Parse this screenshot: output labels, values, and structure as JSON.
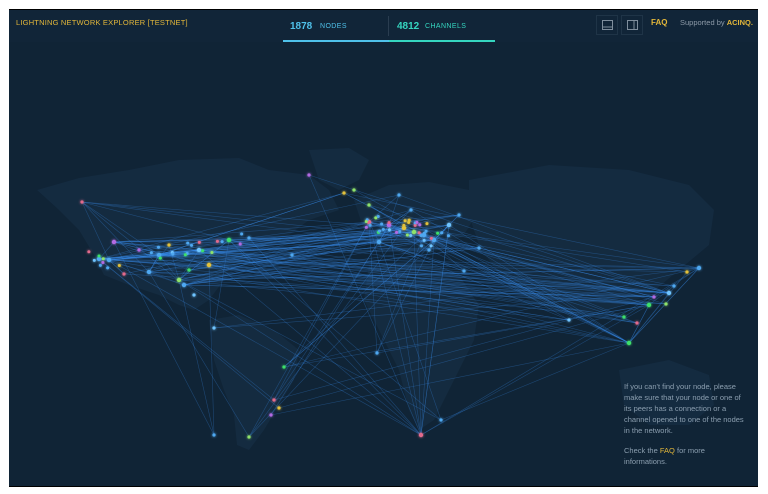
{
  "app": {
    "title": "LIGHTNING NETWORK EXPLORER [TESTNET]"
  },
  "stats": {
    "nodes_count": "1878",
    "nodes_label": "NODES",
    "channels_count": "4812",
    "channels_label": "CHANNELS"
  },
  "header": {
    "faq_label": "FAQ",
    "supported_by": "Supported by",
    "sponsor": "ACINQ."
  },
  "info": {
    "paragraph1": "If you can't find your node, please make sure that your node or one of its peers has a connection or a channel opened to one of the nodes in the network.",
    "check_the": "Check the",
    "faq_link": "FAQ",
    "more_info": "for more informations."
  },
  "colors": {
    "background": "#102436",
    "accent_gold": "#e3b73a",
    "nodes_blue": "#4fc1ea",
    "channels_teal": "#35d6c0",
    "channel_line": "#3a8ef0"
  },
  "icons": [
    "panel-bottom-icon",
    "panel-side-icon"
  ]
}
